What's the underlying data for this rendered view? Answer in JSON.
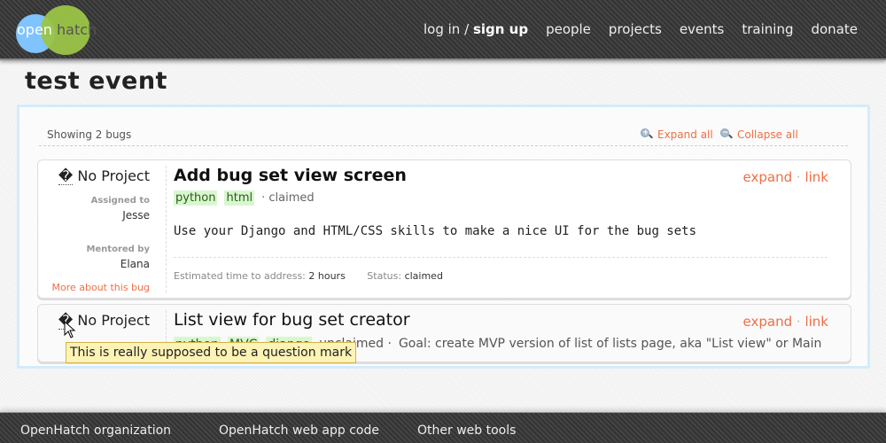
{
  "brand": {
    "logo_left": "open",
    "logo_right": "hatch",
    "colors": {
      "blue": "#7fc3ff",
      "green": "#9bc447",
      "accent": "#ee6f45"
    }
  },
  "nav": {
    "login": "log in",
    "separator": "/",
    "signup": "sign up",
    "items": [
      "people",
      "projects",
      "events",
      "training",
      "donate"
    ]
  },
  "page": {
    "title": "test event"
  },
  "toolbar": {
    "showing": "Showing 2 bugs",
    "expand_all": "Expand all",
    "collapse_all": "Collapse all"
  },
  "bugs": [
    {
      "project_icon": "�",
      "project": "No Project",
      "assigned_label": "Assigned to",
      "assigned": "Jesse",
      "mentored_label": "Mentored by",
      "mentor": "Elana",
      "more": "More about this bug",
      "title": "Add bug set view screen",
      "expand": "expand",
      "link": "link",
      "tags": [
        "python",
        "html"
      ],
      "status_short": "· claimed",
      "description": "Use your Django and HTML/CSS skills to make a nice UI for the bug sets",
      "estimate_label": "Estimated time to address:",
      "estimate": "2 hours",
      "status_label": "Status:",
      "status": "claimed"
    },
    {
      "project_icon": "�",
      "project": "No Project",
      "title": "List view for bug set creator",
      "expand": "expand",
      "link": "link",
      "tags": [
        "python",
        "MVC",
        "django"
      ],
      "status_short": "unclaimed ·",
      "summary": "Goal: create MVP version of list of lists page, aka \"List view\" or Main Screen"
    }
  ],
  "tooltip": "This is really supposed to be a question mark",
  "footer": {
    "links": [
      "OpenHatch organization",
      "OpenHatch web app code",
      "Other web tools"
    ]
  }
}
